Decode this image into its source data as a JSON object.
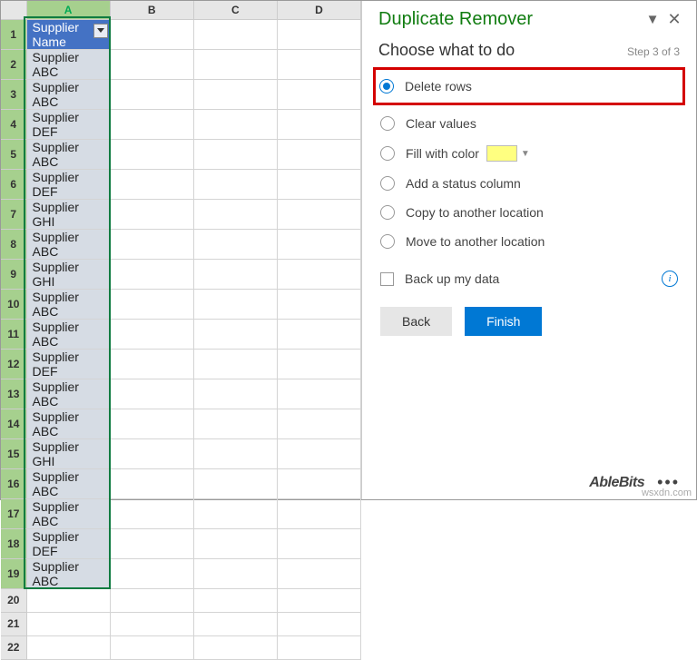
{
  "columns": [
    "A",
    "B",
    "C",
    "D"
  ],
  "rows": [
    {
      "n": 1,
      "v": "Supplier Name",
      "header": true,
      "sel": true,
      "filter": true
    },
    {
      "n": 2,
      "v": "Supplier ABC",
      "sel": true
    },
    {
      "n": 3,
      "v": "Supplier ABC",
      "sel": true
    },
    {
      "n": 4,
      "v": "Supplier DEF",
      "sel": true
    },
    {
      "n": 5,
      "v": "Supplier ABC",
      "sel": true
    },
    {
      "n": 6,
      "v": "Supplier DEF",
      "sel": true
    },
    {
      "n": 7,
      "v": "Supplier GHI",
      "sel": true
    },
    {
      "n": 8,
      "v": "Supplier ABC",
      "sel": true
    },
    {
      "n": 9,
      "v": "Supplier GHI",
      "sel": true
    },
    {
      "n": 10,
      "v": "Supplier ABC",
      "sel": true
    },
    {
      "n": 11,
      "v": "Supplier ABC",
      "sel": true
    },
    {
      "n": 12,
      "v": "Supplier DEF",
      "sel": true
    },
    {
      "n": 13,
      "v": "Supplier ABC",
      "sel": true
    },
    {
      "n": 14,
      "v": "Supplier ABC",
      "sel": true
    },
    {
      "n": 15,
      "v": "Supplier GHI",
      "sel": true
    },
    {
      "n": 16,
      "v": "Supplier ABC",
      "sel": true
    },
    {
      "n": 17,
      "v": "Supplier ABC",
      "sel": true
    },
    {
      "n": 18,
      "v": "Supplier DEF",
      "sel": true
    },
    {
      "n": 19,
      "v": "Supplier ABC",
      "sel": true
    },
    {
      "n": 20,
      "v": "",
      "sel": false
    },
    {
      "n": 21,
      "v": "",
      "sel": false
    },
    {
      "n": 22,
      "v": "",
      "sel": false
    }
  ],
  "pane": {
    "title": "Duplicate Remover",
    "heading": "Choose what to do",
    "step": "Step 3 of 3",
    "options": {
      "delete": "Delete rows",
      "clear": "Clear values",
      "fill": "Fill with color",
      "status": "Add a status column",
      "copy": "Copy to another location",
      "move": "Move to another location"
    },
    "backup": "Back up my data",
    "back": "Back",
    "finish": "Finish",
    "brand": "AbleBits"
  },
  "watermark": "wsxdn.com"
}
